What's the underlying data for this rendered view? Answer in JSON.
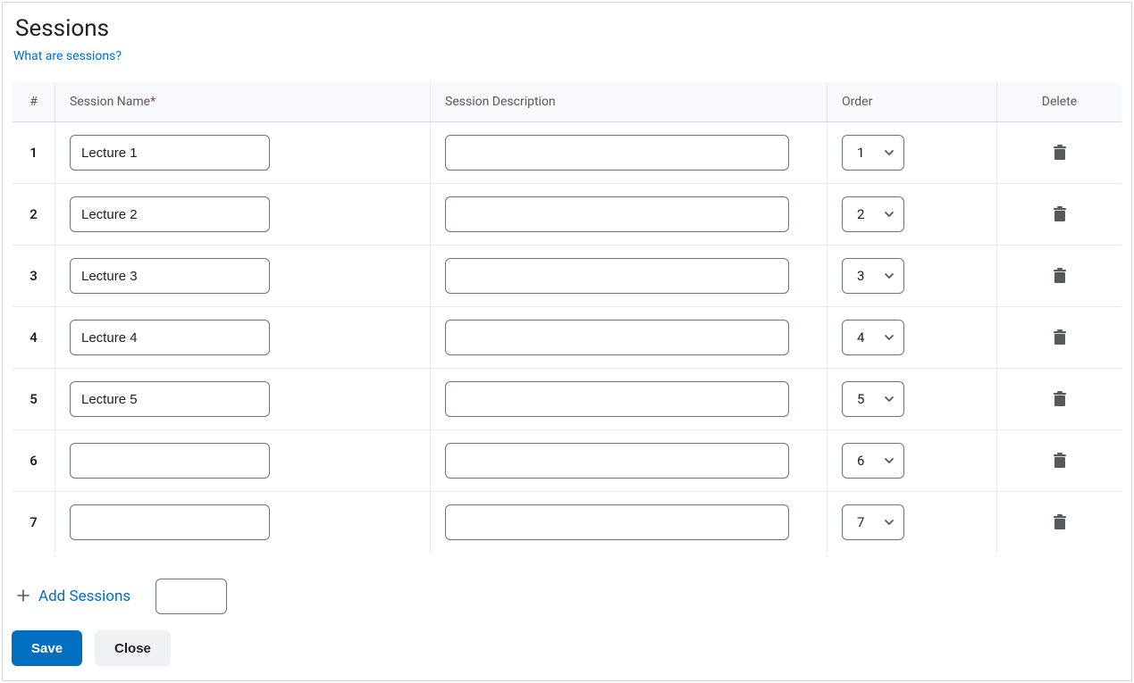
{
  "title": "Sessions",
  "help_link": "What are sessions?",
  "columns": {
    "number": "#",
    "name": "Session Name",
    "name_required_mark": "*",
    "description": "Session Description",
    "order": "Order",
    "delete": "Delete"
  },
  "rows": [
    {
      "num": "1",
      "name": "Lecture 1",
      "description": "",
      "order": "1"
    },
    {
      "num": "2",
      "name": "Lecture 2",
      "description": "",
      "order": "2"
    },
    {
      "num": "3",
      "name": "Lecture 3",
      "description": "",
      "order": "3"
    },
    {
      "num": "4",
      "name": "Lecture 4",
      "description": "",
      "order": "4"
    },
    {
      "num": "5",
      "name": "Lecture 5",
      "description": "",
      "order": "5"
    },
    {
      "num": "6",
      "name": "",
      "description": "",
      "order": "6"
    },
    {
      "num": "7",
      "name": "",
      "description": "",
      "order": "7"
    }
  ],
  "add_sessions": {
    "label": "Add Sessions",
    "count": ""
  },
  "buttons": {
    "save": "Save",
    "close": "Close"
  }
}
